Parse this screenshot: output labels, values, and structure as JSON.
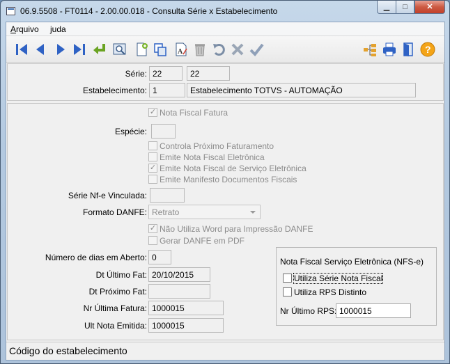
{
  "window": {
    "title": "06.9.5508 - FT0114 - 2.00.00.018 - Consulta Série x Estabelecimento",
    "minimize_glyph": "▁",
    "maximize_glyph": "□",
    "close_glyph": "✕"
  },
  "menu": {
    "arquivo_first": "A",
    "arquivo_rest": "rquivo",
    "ajuda_first": "",
    "ajuda_underlined": "j",
    "ajuda_rest": "uda"
  },
  "toolbar": {
    "icons": [
      "first-record-icon",
      "previous-record-icon",
      "next-record-icon",
      "last-record-icon",
      "goto-icon",
      "search-icon",
      "add-icon",
      "copy-icon",
      "edit-icon",
      "delete-icon",
      "undo-icon",
      "cancel-icon",
      "confirm-icon",
      "tree-icon",
      "print-icon",
      "exit-icon",
      "help-icon"
    ],
    "accent_color": "#2f62c4"
  },
  "header": {
    "serie_label": "Série:",
    "serie_code": "22",
    "serie_desc": "22",
    "estab_label": "Estabelecimento:",
    "estab_code": "1",
    "estab_desc": "Estabelecimento TOTVS - AUTOMAÇÃO"
  },
  "form": {
    "nota_fiscal_fatura": "Nota Fiscal Fatura",
    "especie_label": "Espécie:",
    "especie_value": "",
    "controla_proximo": "Controla Próximo Faturamento",
    "emite_nfe": "Emite Nota Fiscal Eletrônica",
    "emite_nfse": "Emite Nota Fiscal de Serviço Eletrônica",
    "emite_mdfe": "Emite Manifesto Documentos Fiscais",
    "serie_nfe_label": "Série Nf-e Vinculada:",
    "serie_nfe_value": "",
    "formato_label": "Formato DANFE:",
    "formato_value": "Retrato",
    "nao_utiliza_word": "Não Utiliza Word para Impressão DANFE",
    "gerar_pdf": "Gerar DANFE em PDF",
    "dias_label": "Número de dias em Aberto:",
    "dias_value": "0",
    "dt_ultimo_label": "Dt Último Fat:",
    "dt_ultimo_value": "20/10/2015",
    "dt_proximo_label": "Dt Próximo Fat:",
    "dt_proximo_value": "",
    "nr_ultima_label": "Nr Última Fatura:",
    "nr_ultima_value": "1000015",
    "ult_nota_label": "Ult Nota Emitida:",
    "ult_nota_value": "1000015",
    "check_mark": "✓"
  },
  "nfse": {
    "title": "Nota Fiscal Serviço Eletrônica (NFS-e)",
    "utiliza_serie": "Utiliza Série Nota Fiscal",
    "utiliza_rps": "Utiliza RPS Distinto",
    "nr_rps_label": "Nr Último RPS:",
    "nr_rps_value": "1000015"
  },
  "status": {
    "text": "Código do estabelecimento"
  }
}
